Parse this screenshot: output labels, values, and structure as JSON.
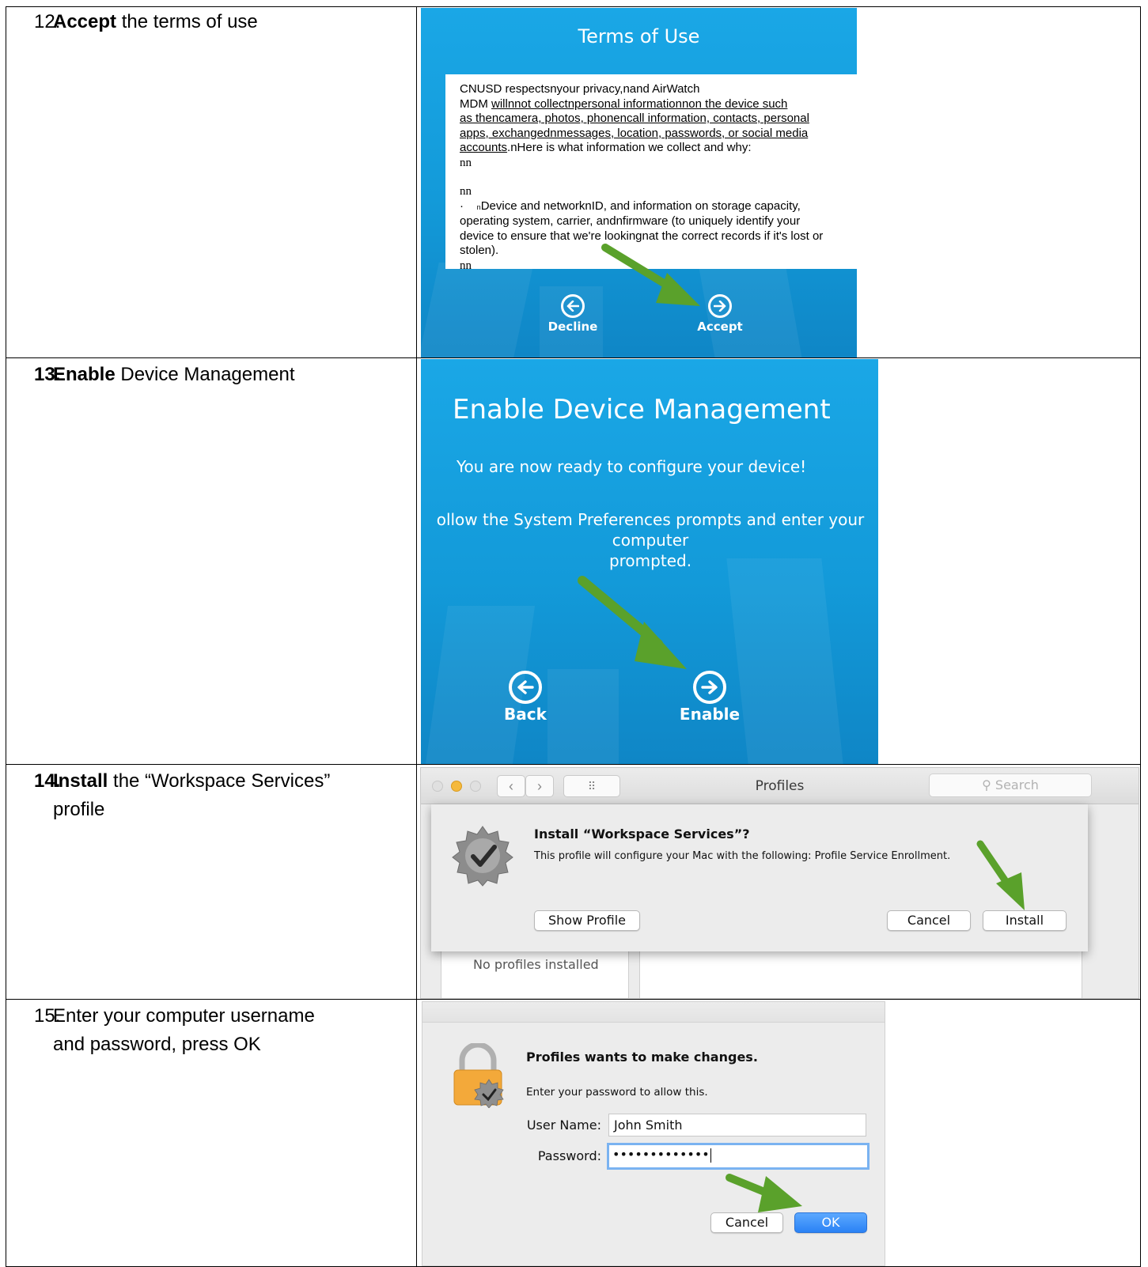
{
  "steps": [
    {
      "number": "12.",
      "bold": "Accept",
      "rest": " the terms of use"
    },
    {
      "number": "13.",
      "bold": "Enable",
      "rest": " Device Management"
    },
    {
      "number": "14.",
      "bold": "Install",
      "rest": " the “Workspace Services”",
      "rest2": "profile"
    },
    {
      "number": "15.",
      "bold": "",
      "rest": "Enter your computer username",
      "rest2": "and password, press OK"
    }
  ],
  "terms_panel": {
    "title": "Terms of Use",
    "line1": "CNUSD respectsnyour privacy,nand AirWatch",
    "line2_plain": "MDM ",
    "line2_u": "willnnot collectnpersonal informationnon the device such",
    "line3_u": "as thencamera, photos, phonencall information, contacts, personal",
    "line4_u": "apps, exchangednmessages, location, passwords, or social media",
    "line5_u": "accounts",
    "line5_plain": ".nHere is what information we collect and why:",
    "nn1": "nn",
    "nn2": "nn",
    "bullet": "·",
    "bullet_mark": "n",
    "bullet_text": "Device and networknID, and information on storage capacity,",
    "line_os": "operating system, carrier, andnfirmware (to uniquely identify your",
    "line_dev": "device to ensure that we're lookingnat the correct records if it's lost or",
    "line_stolen": "stolen).",
    "nn3": "nn",
    "decline_label": "Decline",
    "accept_label": "Accept"
  },
  "enable_panel": {
    "title": "Enable Device Management",
    "line1": "You are now ready to configure your device!",
    "line2": "ollow the System Preferences prompts and enter your computer",
    "line3": "prompted.",
    "back_label": "Back",
    "enable_label": "Enable"
  },
  "profiles_panel": {
    "window_title": "Profiles",
    "search_placeholder": "Search",
    "grid_glyph": "⠿",
    "back_glyph": "‹",
    "forward_glyph": "›",
    "sheet_title": "Install “Workspace Services”?",
    "sheet_text": "This profile will configure your Mac with the following: Profile Service Enrollment.",
    "show_profile_label": "Show Profile",
    "cancel_label": "Cancel",
    "install_label": "Install",
    "empty_list_text": "No profiles installed"
  },
  "auth_panel": {
    "title": "Profiles wants to make changes.",
    "subtitle": "Enter your password to allow this.",
    "username_label": "User Name:",
    "username_value": "John Smith",
    "password_label": "Password:",
    "password_value": "•••••••••••••",
    "cancel_label": "Cancel",
    "ok_label": "OK"
  },
  "colors": {
    "panel_blue": "#1aa7e6",
    "arrow_green": "#5aa12b",
    "mac_blue": "#2a82f5"
  }
}
